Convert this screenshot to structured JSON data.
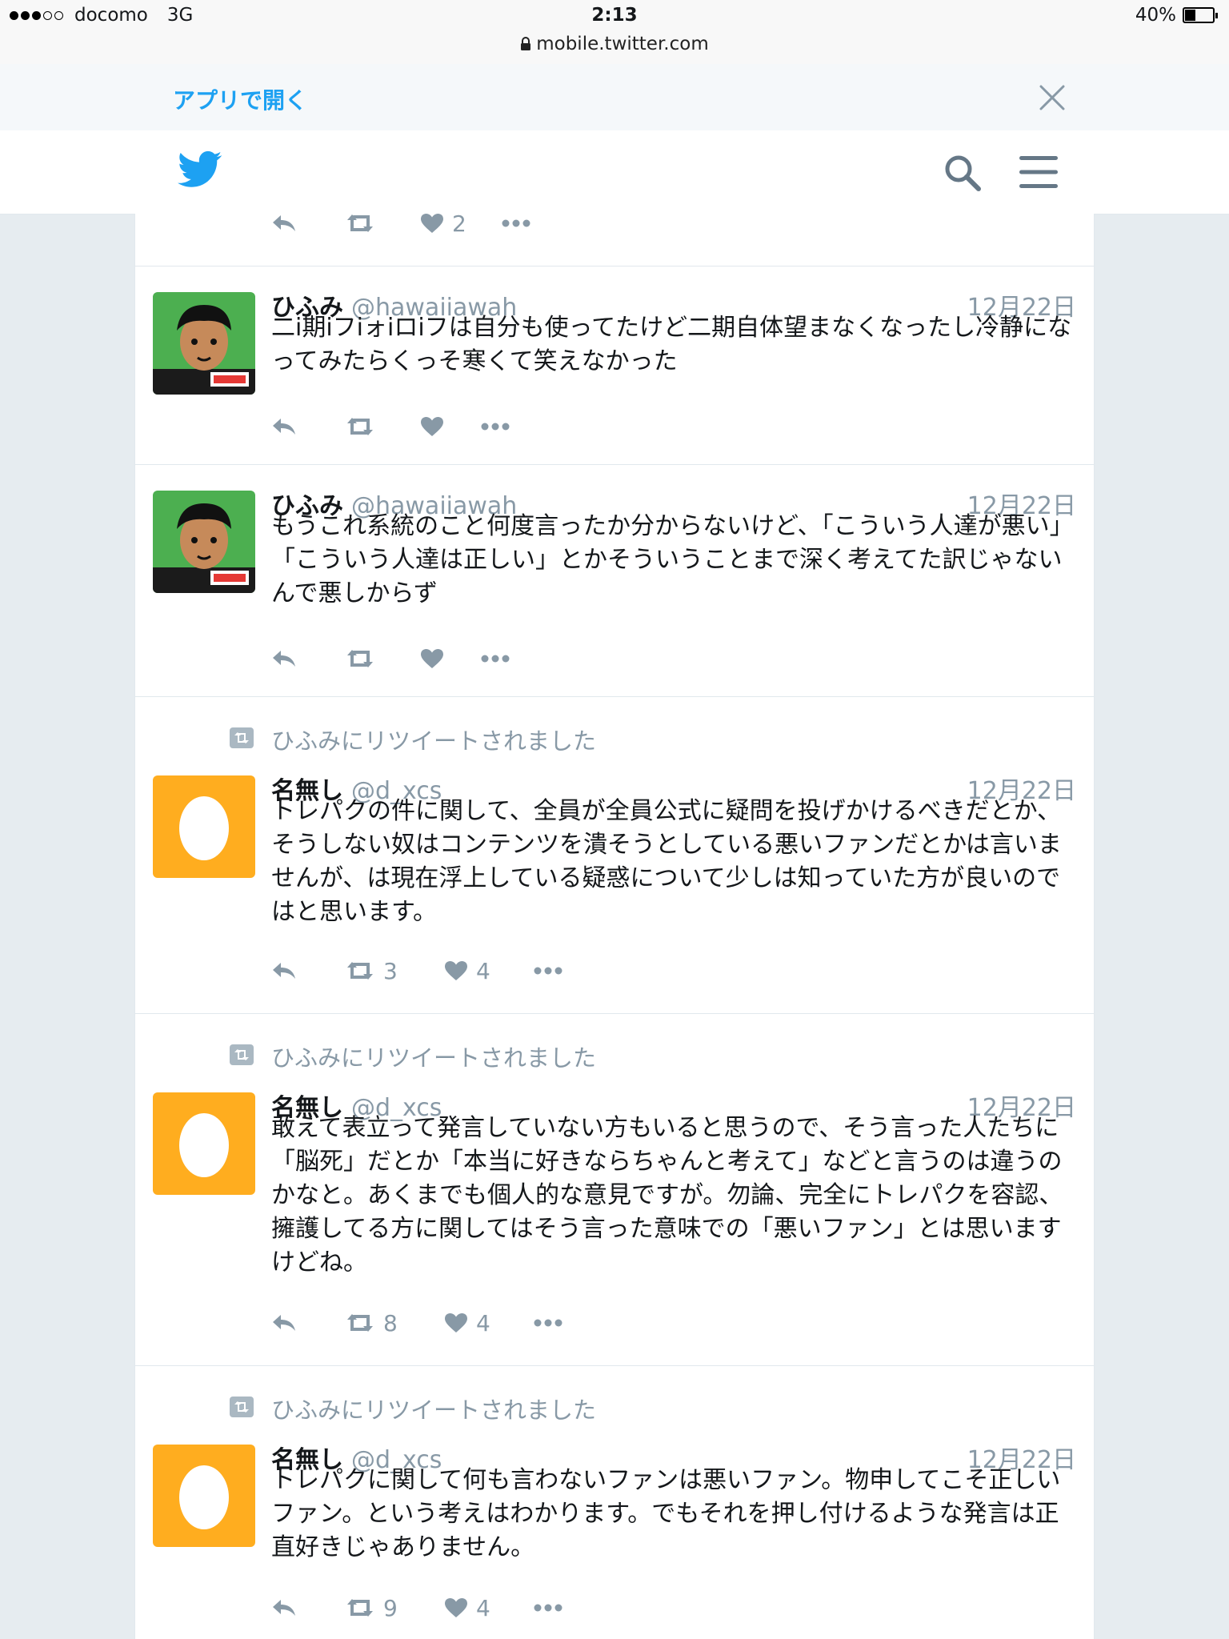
{
  "status_bar": {
    "carrier": "docomo",
    "network": "3G",
    "time": "2:13",
    "url": "mobile.twitter.com",
    "battery_label": "40%",
    "battery_level": 0.4
  },
  "banner": {
    "open_in_app": "アプリで開く",
    "close_icon": "close-icon"
  },
  "header": {
    "logo_icon": "twitter-bird-icon",
    "search_icon": "search-icon",
    "menu_icon": "menu-icon"
  },
  "colors": {
    "twitter_blue": "#1da1f2",
    "muted_gray": "#8899a6",
    "egg_orange": "#ffad1f",
    "avatar_green": "#4caf50"
  },
  "partial_tweet": {
    "like_count": "2"
  },
  "tweets": [
    {
      "retweeted_by": "",
      "name": "ひふみ",
      "handle": "@hawaiiawah",
      "date": "12月22日",
      "text": "二i期iフiォiロiフは自分も使ってたけど二期自体望まなくなったし冷静になってみたらくっそ寒くて笑えなかった",
      "retweet_count": "",
      "like_count": ""
    },
    {
      "retweeted_by": "",
      "name": "ひふみ",
      "handle": "@hawaiiawah",
      "date": "12月22日",
      "text": "もうこれ系統のこと何度言ったか分からないけど、「こういう人達が悪い」「こういう人達は正しい」とかそういうことまで深く考えてた訳じゃないんで悪しからず",
      "retweet_count": "",
      "like_count": ""
    },
    {
      "retweeted_by": "ひふみにリツイートされました",
      "name": "名無し",
      "handle": "@d_xcs",
      "date": "12月22日",
      "text": "トレパクの件に関して、全員が全員公式に疑問を投げかけるべきだとか、そうしない奴はコンテンツを潰そうとしている悪いファンだとかは言いませんが、は現在浮上している疑惑について少しは知っていた方が良いのではと思います。",
      "retweet_count": "3",
      "like_count": "4"
    },
    {
      "retweeted_by": "ひふみにリツイートされました",
      "name": "名無し",
      "handle": "@d_xcs",
      "date": "12月22日",
      "text": "敢えて表立って発言していない方もいると思うので、そう言った人たちに「脳死」だとか「本当に好きならちゃんと考えて」などと言うのは違うのかなと。あくまでも個人的な意見ですが。勿論、完全にトレパクを容認、擁護してる方に関してはそう言った意味での「悪いファン」とは思いますけどね。",
      "retweet_count": "8",
      "like_count": "4"
    },
    {
      "retweeted_by": "ひふみにリツイートされました",
      "name": "名無し",
      "handle": "@d_xcs",
      "date": "12月22日",
      "text": "トレパクに関して何も言わないファンは悪いファン。物申してこそ正しいファン。という考えはわかります。でもそれを押し付けるような発言は正直好きじゃありません。",
      "retweet_count": "9",
      "like_count": "4"
    }
  ]
}
